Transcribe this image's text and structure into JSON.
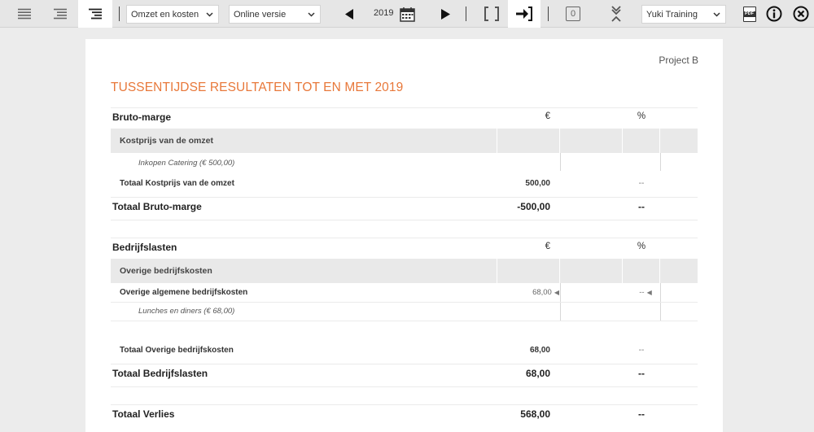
{
  "toolbar": {
    "icons": [
      "align-left-icon",
      "align-right-icon",
      "align-indent-icon",
      "calendar-icon",
      "previous-icon",
      "next-icon",
      "brackets-icon",
      "export-icon",
      "zero-icon",
      "collapse-icon",
      "pdf-icon",
      "info-icon",
      "close-icon"
    ],
    "report_select": "Omzet en kosten",
    "version_select": "Online versie",
    "year": "2019",
    "zero_label": "0",
    "company_select": "Yuki Training",
    "pdf_label": "PDF"
  },
  "report": {
    "project": "Project B",
    "title": "TUSSENTIJDSE RESULTATEN TOT EN MET 2019",
    "gross": {
      "header": "Bruto-marge",
      "currency": "€",
      "percent": "%",
      "section": "Kostprijs van de omzet",
      "detail": "Inkopen Catering (€ 500,00)",
      "subtotal_label": "Totaal Kostprijs van de omzet",
      "subtotal_value": "500,00",
      "subtotal_pct": "--",
      "total_label": "Totaal Bruto-marge",
      "total_value": "-500,00",
      "total_pct": "--"
    },
    "expenses": {
      "header": "Bedrijfslasten",
      "currency": "€",
      "percent": "%",
      "section": "Overige bedrijfskosten",
      "line_label": "Overige algemene bedrijfskosten",
      "line_value": "68,00",
      "line_pct": "--",
      "detail": "Lunches en diners (€ 68,00)",
      "subtotal_label": "Totaal Overige bedrijfskosten",
      "subtotal_value": "68,00",
      "subtotal_pct": "--",
      "total_label": "Totaal Bedrijfslasten",
      "total_value": "68,00",
      "total_pct": "--"
    },
    "result": {
      "label": "Totaal Verlies",
      "value": "568,00",
      "pct": "--"
    }
  }
}
